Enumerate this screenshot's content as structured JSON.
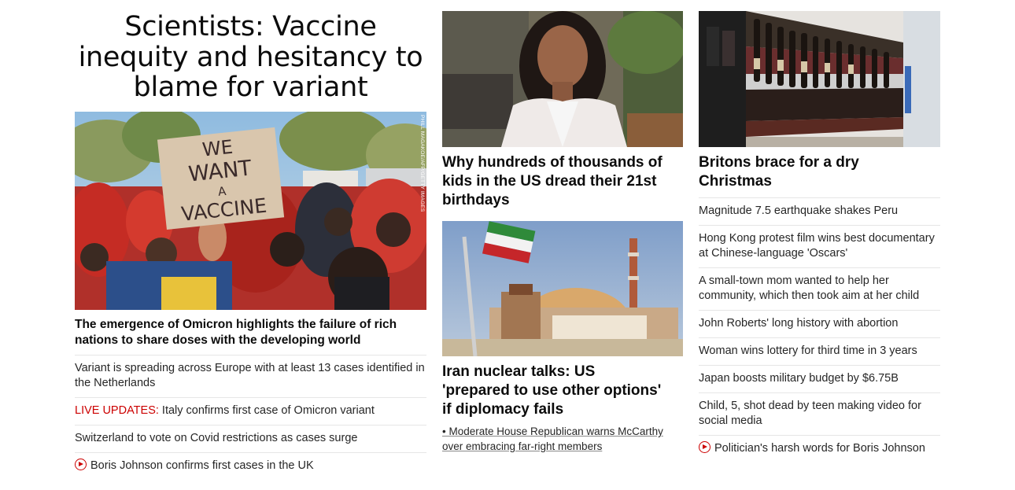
{
  "left": {
    "headline": [
      "Scientists: Vaccine",
      "inequity and hesitancy to",
      "blame for variant"
    ],
    "image": {
      "sign_text": [
        "WE",
        "WANT",
        "A",
        "VACCINE"
      ],
      "credit": "PHILL MAGAKOE/AFP/GETTY IMAGES"
    },
    "caption": "The emergence of Omicron highlights the failure of rich nations to share doses with the developing world",
    "items": [
      {
        "text": "Variant is spreading across Europe with at least 13 cases identified in the Netherlands"
      },
      {
        "live": "LIVE UPDATES:",
        "text": " Italy confirms first case of Omicron variant"
      },
      {
        "text": "Switzerland to vote on Covid restrictions as cases surge"
      },
      {
        "video": true,
        "text": "Boris Johnson confirms first cases in the UK"
      }
    ]
  },
  "middle": {
    "card1": {
      "title": [
        "Why hundreds of thousands of",
        "kids in the US dread their 21st",
        "birthdays"
      ]
    },
    "card2": {
      "title": [
        "Iran nuclear talks: US",
        "'prepared to use other options'",
        "if diplomacy fails"
      ],
      "sub": [
        "• Moderate House Republican warns McCarthy",
        "over embracing far-right members"
      ]
    }
  },
  "right": {
    "card": {
      "title": [
        "Britons brace for a dry",
        "Christmas"
      ]
    },
    "items": [
      {
        "text": "Magnitude 7.5 earthquake shakes Peru"
      },
      {
        "text": "Hong Kong protest film wins best documentary at Chinese-language 'Oscars'"
      },
      {
        "text": "A small-town mom wanted to help her community, which then took aim at her child"
      },
      {
        "text": "John Roberts' long history with abortion"
      },
      {
        "text": "Woman wins lottery for third time in 3 years"
      },
      {
        "text": "Japan boosts military budget by $6.75B"
      },
      {
        "text": "Child, 5, shot dead by teen making video for social media"
      },
      {
        "video": true,
        "text": "Politician's harsh words for Boris Johnson"
      }
    ]
  },
  "colors": {
    "live": "#cc0000",
    "divider": "#e6e6e6",
    "text": "#262626"
  }
}
